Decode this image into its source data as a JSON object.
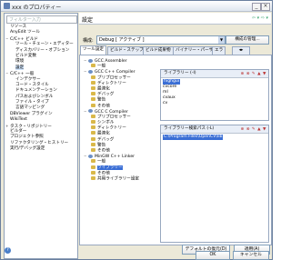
{
  "window": {
    "title": "xxx のプロパティー"
  },
  "filter": {
    "placeholder": "フィルター入力"
  },
  "sidebar": {
    "items": [
      {
        "label": "リソース",
        "indent": 0,
        "twisty": ""
      },
      {
        "label": "AnyEdit ツール",
        "indent": 0,
        "twisty": ""
      },
      {
        "label": "C/C++ ビルド",
        "indent": 0,
        "twisty": "−"
      },
      {
        "label": "ツール・チェーン・エディター",
        "indent": 1,
        "twisty": ""
      },
      {
        "label": "ディスカバリー・オプション",
        "indent": 1,
        "twisty": ""
      },
      {
        "label": "ビルド変数",
        "indent": 1,
        "twisty": ""
      },
      {
        "label": "環境",
        "indent": 1,
        "twisty": ""
      },
      {
        "label": "設定",
        "indent": 1,
        "twisty": "",
        "selected": true
      },
      {
        "label": "C/C++ 一般",
        "indent": 0,
        "twisty": "−"
      },
      {
        "label": "インデクサー",
        "indent": 1,
        "twisty": ""
      },
      {
        "label": "コード・スタイル",
        "indent": 1,
        "twisty": ""
      },
      {
        "label": "ドキュメンテーション",
        "indent": 1,
        "twisty": ""
      },
      {
        "label": "パスおよびシンボル",
        "indent": 1,
        "twisty": ""
      },
      {
        "label": "ファイル・タイプ",
        "indent": 1,
        "twisty": ""
      },
      {
        "label": "言語マッピング",
        "indent": 1,
        "twisty": ""
      },
      {
        "label": "DBViewer プラグイン",
        "indent": 0,
        "twisty": ""
      },
      {
        "label": "WikiText",
        "indent": 0,
        "twisty": ""
      },
      {
        "label": "タスク・リポジトリー",
        "indent": 0,
        "twisty": "+"
      },
      {
        "label": "ビルダー",
        "indent": 0,
        "twisty": ""
      },
      {
        "label": "プロジェクト参照",
        "indent": 0,
        "twisty": ""
      },
      {
        "label": "リファクタリング・ヒストリー",
        "indent": 0,
        "twisty": ""
      },
      {
        "label": "実行/デバッグ設定",
        "indent": 0,
        "twisty": ""
      }
    ]
  },
  "header": {
    "title": "設定",
    "nav": "⇦ ▾ ⇨ ▾"
  },
  "config": {
    "label": "構成:",
    "value": "Debug [ アクティブ ]",
    "manage_button": "構成の管理..."
  },
  "tabs": [
    {
      "label": "ツール設定",
      "active": true
    },
    {
      "label": "ビルド・ステップ",
      "active": false
    },
    {
      "label": "ビルド成果物",
      "active": false
    },
    {
      "label": "バイナリー・パーサー",
      "active": false
    },
    {
      "label": "エラ",
      "active": false
    }
  ],
  "tool_tree": [
    {
      "label": "GCC Assembler",
      "indent": 0,
      "twisty": "−",
      "icon": "gear-icon"
    },
    {
      "label": "一般",
      "indent": 1,
      "icon": "folder-icon"
    },
    {
      "label": "GCC C++ Compiler",
      "indent": 0,
      "twisty": "−",
      "icon": "gear-icon"
    },
    {
      "label": "プリプロセッサー",
      "indent": 1,
      "icon": "folder-icon"
    },
    {
      "label": "ディレクトリー",
      "indent": 1,
      "icon": "folder-icon"
    },
    {
      "label": "最適化",
      "indent": 1,
      "icon": "folder-icon"
    },
    {
      "label": "デバッグ",
      "indent": 1,
      "icon": "folder-icon"
    },
    {
      "label": "警告",
      "indent": 1,
      "icon": "folder-icon"
    },
    {
      "label": "その他",
      "indent": 1,
      "icon": "folder-icon"
    },
    {
      "label": "GCC C Compiler",
      "indent": 0,
      "twisty": "−",
      "icon": "gear-icon"
    },
    {
      "label": "プリプロセッサー",
      "indent": 1,
      "icon": "folder-icon"
    },
    {
      "label": "シンボル",
      "indent": 1,
      "icon": "folder-icon"
    },
    {
      "label": "ディレクトリー",
      "indent": 1,
      "icon": "folder-icon"
    },
    {
      "label": "最適化",
      "indent": 1,
      "icon": "folder-icon"
    },
    {
      "label": "デバッグ",
      "indent": 1,
      "icon": "folder-icon"
    },
    {
      "label": "警告",
      "indent": 1,
      "icon": "folder-icon"
    },
    {
      "label": "その他",
      "indent": 1,
      "icon": "folder-icon"
    },
    {
      "label": "MinGW C++ Linker",
      "indent": 0,
      "twisty": "−",
      "icon": "gear-icon"
    },
    {
      "label": "一般",
      "indent": 1,
      "icon": "folder-icon"
    },
    {
      "label": "ライブラリー",
      "indent": 1,
      "icon": "folder-icon",
      "selected": true
    },
    {
      "label": "その他",
      "indent": 1,
      "icon": "folder-icon"
    },
    {
      "label": "共用ライブラリー設定",
      "indent": 1,
      "icon": "folder-icon"
    }
  ],
  "libraries": {
    "title": "ライブラリー (-l)",
    "items": [
      "highgui",
      "cvcore",
      "ml",
      "cvaux",
      "cv"
    ]
  },
  "library_paths": {
    "title": "ライブラリー検索パス (-L)",
    "items": [
      "C:\\Program Files\\OpenCV\\lib"
    ]
  },
  "buttons": {
    "restore": "デフォルトの復元(D)",
    "apply": "適用(A)",
    "ok": "OK",
    "cancel": "キャンセル"
  },
  "help_icon": "?",
  "colors": {
    "selection": "#3a6ed5",
    "window_bg": "#ece9d8",
    "titlebar_border": "#6a7f9e"
  }
}
